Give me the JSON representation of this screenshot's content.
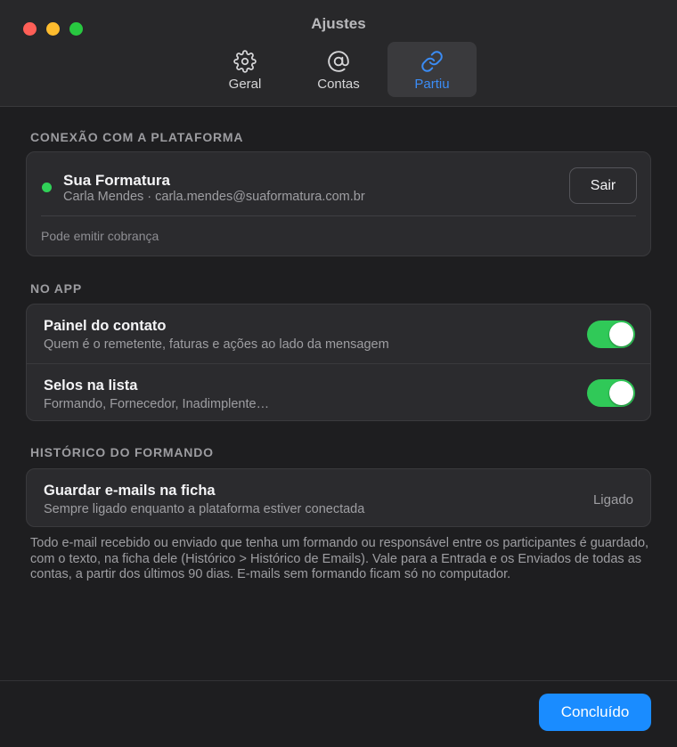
{
  "window": {
    "title": "Ajustes"
  },
  "tabs": [
    {
      "label": "Geral",
      "icon": "gear-icon"
    },
    {
      "label": "Contas",
      "icon": "at-sign-icon"
    },
    {
      "label": "Partiu",
      "icon": "link-icon",
      "active": true
    }
  ],
  "accent_color": "#3b8cf5",
  "connection": {
    "section_title": "CONEXÃO COM A PLATAFORMA",
    "platform_name": "Sua Formatura",
    "account": "Carla Mendes · carla.mendes@suaformatura.com.br",
    "status": "connected",
    "status_color": "#30d158",
    "logout_label": "Sair",
    "permission": "Pode emitir cobrança"
  },
  "in_app": {
    "section_title": "NO APP",
    "items": [
      {
        "title": "Painel do contato",
        "subtitle": "Quem é o remetente, faturas e ações ao lado da mensagem",
        "enabled": true
      },
      {
        "title": "Selos na lista",
        "subtitle": "Formando, Fornecedor, Inadimplente…",
        "enabled": true
      }
    ]
  },
  "history": {
    "section_title": "HISTÓRICO DO FORMANDO",
    "title": "Guardar e-mails na ficha",
    "subtitle": "Sempre ligado enquanto a plataforma estiver conectada",
    "status": "Ligado",
    "footnote": "Todo e-mail recebido ou enviado que tenha um formando ou responsável entre os participantes é guardado, com o texto, na ficha dele (Histórico > Histórico de Emails). Vale para a Entrada e os Enviados de todas as contas, a partir dos últimos 90 dias. E-mails sem formando ficam só no computador."
  },
  "footer": {
    "done_label": "Concluído"
  }
}
